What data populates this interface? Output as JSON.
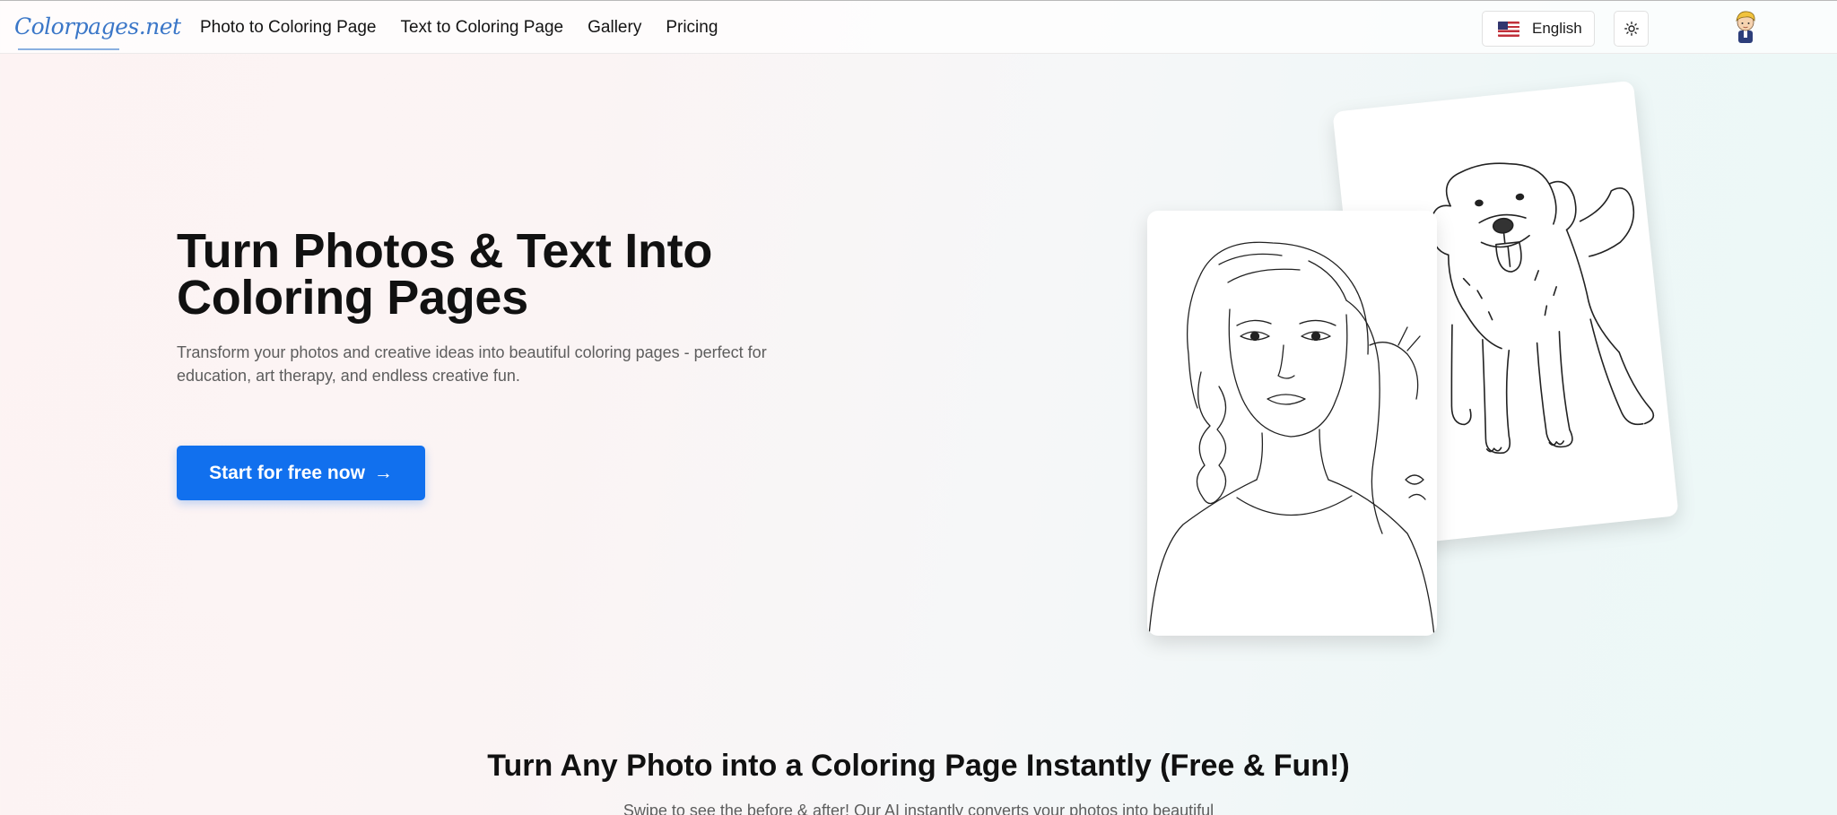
{
  "brand": {
    "logo_text": "Colorpages.net"
  },
  "nav": {
    "links": [
      "Photo to Coloring Page",
      "Text to Coloring Page",
      "Gallery",
      "Pricing"
    ],
    "language": "English",
    "theme_icon": "sun-icon",
    "avatar_icon": "user-avatar"
  },
  "hero": {
    "title_line1": "Turn Photos & Text Into",
    "title_line2": "Coloring Pages",
    "subtitle": "Transform your photos and creative ideas into beautiful coloring pages - perfect for education, art therapy, and endless creative fun.",
    "cta_label": "Start for free now",
    "cta_arrow": "→"
  },
  "section": {
    "title": "Turn Any Photo into a Coloring Page Instantly (Free & Fun!)",
    "subtitle": "Swipe to see the before & after! Our AI instantly converts your photos into beautiful"
  },
  "colors": {
    "accent": "#1170ee",
    "logo": "#3b77c8"
  }
}
